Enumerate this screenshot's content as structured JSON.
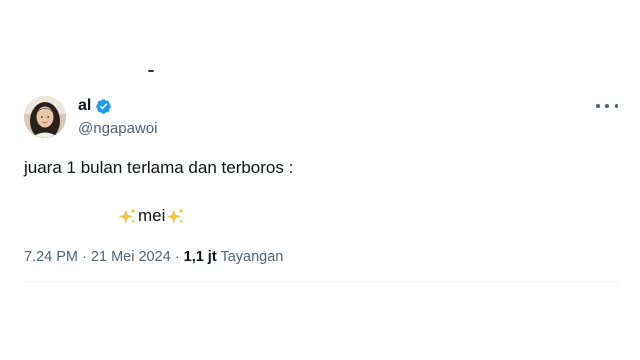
{
  "tweet": {
    "author": {
      "display_name": "al",
      "handle": "@ngapawoi",
      "verified": true
    },
    "text": "juara 1 bulan terlama dan terboros :",
    "highlight_word": "mei",
    "time": "7.24 PM",
    "separator": "·",
    "date": "21 Mei 2024",
    "views_count": "1,1 jt",
    "views_label": "Tayangan"
  },
  "colors": {
    "text_primary": "#0f1419",
    "text_secondary": "#536471",
    "verified_blue": "#1d9bf0",
    "sparkle": "#f4c542",
    "divider": "#eff3f4"
  },
  "icons": {
    "verified": "verified-badge-icon",
    "more": "more-options-icon",
    "sparkles": "sparkles-icon"
  }
}
